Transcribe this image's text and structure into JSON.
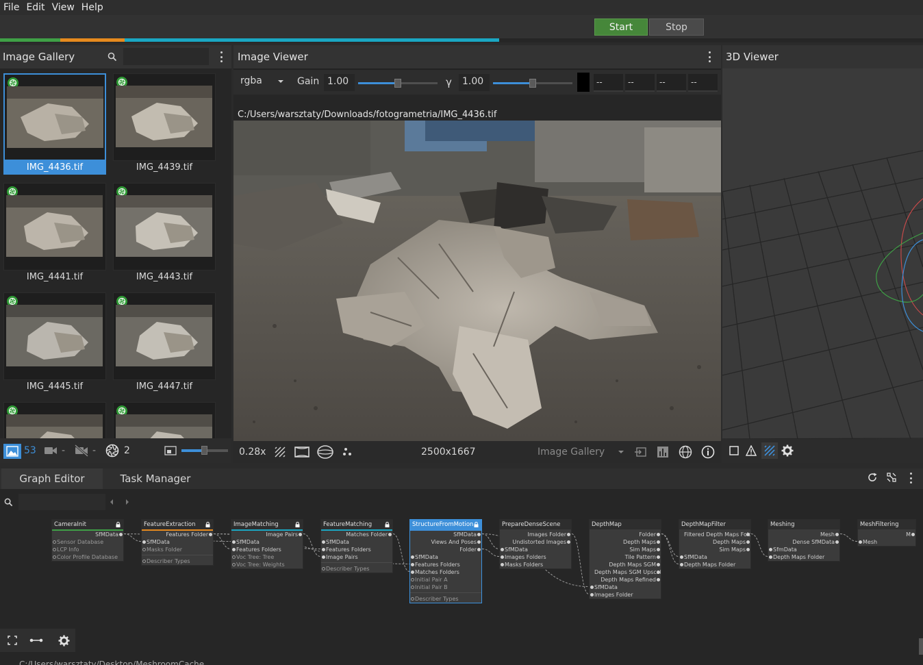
{
  "menu": [
    "File",
    "Edit",
    "View",
    "Help"
  ],
  "toolbar": {
    "start_label": "Start",
    "stop_label": "Stop"
  },
  "progress_segments": [
    {
      "color": "#3fa046",
      "fraction": 0.065
    },
    {
      "color": "#e68a1e",
      "fraction": 0.07
    },
    {
      "color": "#1aa7c3",
      "fraction": 0.406
    }
  ],
  "gallery": {
    "title": "Image Gallery",
    "search_placeholder": "",
    "images": [
      {
        "name": "IMG_4436.tif",
        "selected": true
      },
      {
        "name": "IMG_4439.tif",
        "selected": false
      },
      {
        "name": "IMG_4441.tif",
        "selected": false
      },
      {
        "name": "IMG_4443.tif",
        "selected": false
      },
      {
        "name": "IMG_4445.tif",
        "selected": false
      },
      {
        "name": "IMG_4447.tif",
        "selected": false
      },
      {
        "name": "",
        "selected": false
      },
      {
        "name": "",
        "selected": false
      }
    ],
    "footer": {
      "images_count": "53",
      "cameras_value": "-",
      "rejected_value": "-",
      "intrinsics_count": "2"
    }
  },
  "viewer": {
    "title": "Image Viewer",
    "channel": "rgba",
    "gain_label": "Gain",
    "gain_value": "1.00",
    "gamma_label": "γ",
    "gamma_value": "1.00",
    "pixel_values": [
      "--",
      "--",
      "--",
      "--"
    ],
    "image_path": "C:/Users/warsztaty/Downloads/fotogrametria/IMG_4436.tif",
    "zoom": "0.28x",
    "resolution": "2500x1667",
    "source": "Image Gallery"
  },
  "viewer3d": {
    "title": "3D Viewer"
  },
  "graph": {
    "tabs": [
      {
        "label": "Graph Editor",
        "active": true
      },
      {
        "label": "Task Manager",
        "active": false
      }
    ],
    "nodes": [
      {
        "title": "CameraInit",
        "bar": "#3fa046",
        "selected": false,
        "outputs": [
          "SfMData"
        ],
        "inputs": [
          {
            "n": "Sensor Database",
            "c": false
          },
          {
            "n": "LCP Info",
            "c": false
          },
          {
            "n": "Color Profile Database",
            "c": false
          }
        ],
        "extra": []
      },
      {
        "title": "FeatureExtraction",
        "bar": "#e68a1e",
        "selected": false,
        "outputs": [
          "Features Folder"
        ],
        "inputs": [
          {
            "n": "SfMData",
            "c": true
          },
          {
            "n": "Masks Folder",
            "c": false
          }
        ],
        "extra": [
          {
            "n": "Describer Types",
            "c": false
          }
        ]
      },
      {
        "title": "ImageMatching",
        "bar": "#1aa7c3",
        "selected": false,
        "outputs": [
          "Image Pairs"
        ],
        "inputs": [
          {
            "n": "SfMData",
            "c": true
          },
          {
            "n": "Features Folders",
            "c": true
          },
          {
            "n": "Voc Tree: Tree",
            "c": false
          },
          {
            "n": "Voc Tree: Weights",
            "c": false
          }
        ],
        "extra": []
      },
      {
        "title": "FeatureMatching",
        "bar": "#1aa7c3",
        "selected": false,
        "outputs": [
          "Matches Folder"
        ],
        "inputs": [
          {
            "n": "SfMData",
            "c": true
          },
          {
            "n": "Features Folders",
            "c": true
          },
          {
            "n": "Image Pairs",
            "c": true
          }
        ],
        "extra": [
          {
            "n": "Describer Types",
            "c": false
          }
        ]
      },
      {
        "title": "StructureFromMotion",
        "bar": "#3d8fd9",
        "selected": true,
        "outputs": [
          "SfMData",
          "Views And Poses",
          "Folder"
        ],
        "inputs": [
          {
            "n": "SfMData",
            "c": true
          },
          {
            "n": "Features Folders",
            "c": true
          },
          {
            "n": "Matches Folders",
            "c": true
          },
          {
            "n": "Initial Pair A",
            "c": false
          },
          {
            "n": "Initial Pair B",
            "c": false
          }
        ],
        "extra": [
          {
            "n": "Describer Types",
            "c": false
          }
        ]
      },
      {
        "title": "PrepareDenseScene",
        "bar": "",
        "selected": false,
        "outputs": [
          "Images Folder",
          "Undistorted Images"
        ],
        "inputs": [
          {
            "n": "SfMData",
            "c": true
          },
          {
            "n": "Images Folders",
            "c": true
          },
          {
            "n": "Masks Folders",
            "c": true
          }
        ],
        "extra": []
      },
      {
        "title": "DepthMap",
        "bar": "",
        "selected": false,
        "outputs": [
          "Folder",
          "Depth Maps",
          "Sim Maps",
          "Tile Pattern",
          "Depth Maps SGM",
          "Depth Maps SGM Upscaled",
          "Depth Maps Refined"
        ],
        "inputs": [
          {
            "n": "SfMData",
            "c": true
          },
          {
            "n": "Images Folder",
            "c": true
          }
        ],
        "extra": []
      },
      {
        "title": "DepthMapFilter",
        "bar": "",
        "selected": false,
        "outputs": [
          "Filtered Depth Maps Folder",
          "Depth Maps",
          "Sim Maps"
        ],
        "inputs": [
          {
            "n": "SfMData",
            "c": true
          },
          {
            "n": "Depth Maps Folder",
            "c": true
          }
        ],
        "extra": []
      },
      {
        "title": "Meshing",
        "bar": "",
        "selected": false,
        "outputs": [
          "Mesh",
          "Dense SfMData"
        ],
        "inputs": [
          {
            "n": "SfmData",
            "c": true
          },
          {
            "n": "Depth Maps Folder",
            "c": true
          }
        ],
        "extra": []
      },
      {
        "title": "MeshFiltering",
        "bar": "",
        "selected": false,
        "outputs": [
          "M"
        ],
        "inputs": [
          {
            "n": "Mesh",
            "c": true
          }
        ],
        "extra": []
      }
    ]
  },
  "cache_path": "C:/Users/warsztaty/Desktop/MeshroomCache"
}
